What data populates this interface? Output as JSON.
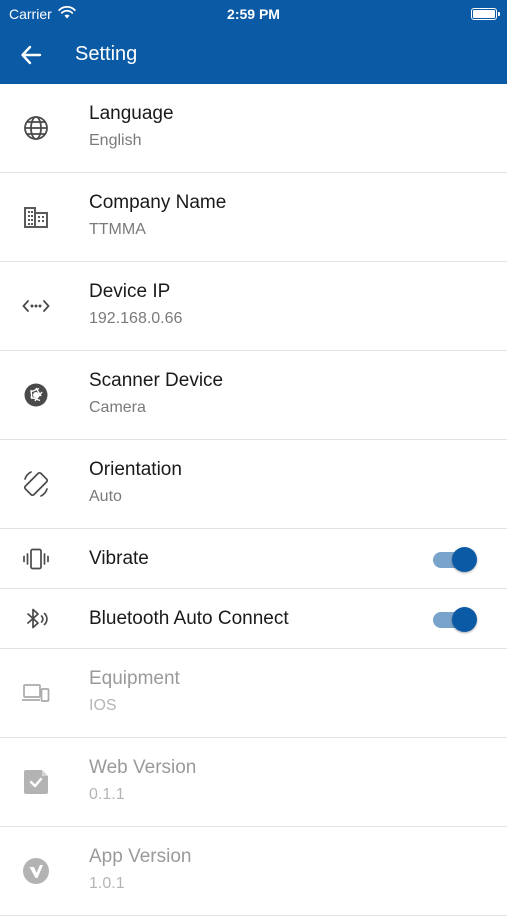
{
  "status_bar": {
    "carrier": "Carrier",
    "time": "2:59 PM"
  },
  "header": {
    "title": "Setting"
  },
  "colors": {
    "brand": "#0b5aa6",
    "toggle_track": "#7aa3cc"
  },
  "settings": [
    {
      "icon": "globe-icon",
      "title": "Language",
      "value": "English"
    },
    {
      "icon": "building-icon",
      "title": "Company Name",
      "value": "TTMMA"
    },
    {
      "icon": "code-dots-icon",
      "title": "Device IP",
      "value": "192.168.0.66"
    },
    {
      "icon": "camera-aperture-icon",
      "title": "Scanner Device",
      "value": "Camera"
    },
    {
      "icon": "screen-rotation-icon",
      "title": "Orientation",
      "value": "Auto"
    },
    {
      "icon": "vibrate-icon",
      "title": "Vibrate",
      "toggle": true
    },
    {
      "icon": "bluetooth-audio-icon",
      "title": "Bluetooth Auto Connect",
      "toggle": true
    },
    {
      "icon": "devices-icon",
      "title": "Equipment",
      "value": "IOS"
    },
    {
      "icon": "web-check-icon",
      "title": "Web Version",
      "value": "0.1.1"
    },
    {
      "icon": "app-logo-icon",
      "title": "App Version",
      "value": "1.0.1"
    }
  ]
}
